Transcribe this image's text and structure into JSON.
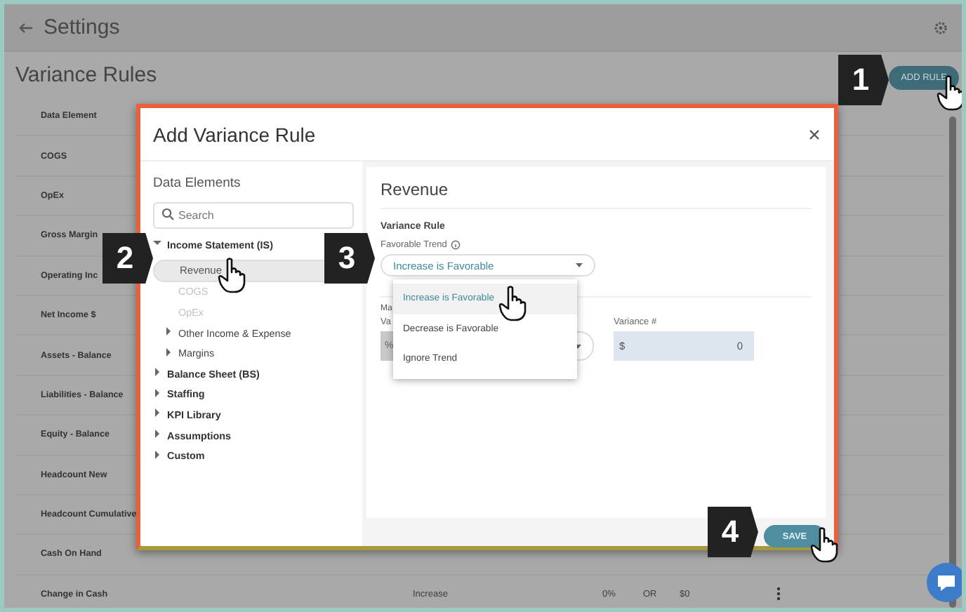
{
  "top_bar": {
    "title": "Settings"
  },
  "page": {
    "title": "Variance Rules",
    "add_button": "ADD RULE"
  },
  "table": {
    "rows": [
      {
        "element": "Data Element",
        "cells": []
      },
      {
        "element": "COGS",
        "cells": []
      },
      {
        "element": "OpEx",
        "cells": []
      },
      {
        "element": "Gross Margin",
        "cells": []
      },
      {
        "element": "Operating Inc",
        "cells": []
      },
      {
        "element": "Net Income $",
        "cells": []
      },
      {
        "element": "Assets - Balance",
        "cells": []
      },
      {
        "element": "Liabilities - Balance",
        "cells": []
      },
      {
        "element": "Equity - Balance",
        "cells": []
      },
      {
        "element": "Headcount New",
        "cells": []
      },
      {
        "element": "Headcount Cumulative",
        "cells": []
      },
      {
        "element": "Cash On Hand",
        "cells": []
      },
      {
        "element": "Change in Cash",
        "cells": [
          "Increase",
          "0%",
          "OR",
          "$0"
        ]
      }
    ]
  },
  "dialog": {
    "title": "Add Variance Rule",
    "left_panel": {
      "heading": "Data Elements",
      "search": {
        "placeholder": "Search"
      },
      "tree": [
        {
          "label": "Income Statement (IS)",
          "kind": "group",
          "expanded": true,
          "children": [
            {
              "label": "Revenue",
              "kind": "leaf",
              "selected": true,
              "disabled": false
            },
            {
              "label": "COGS",
              "kind": "leaf",
              "selected": false,
              "disabled": true
            },
            {
              "label": "OpEx",
              "kind": "leaf",
              "selected": false,
              "disabled": true
            },
            {
              "label": "Other Income & Expense",
              "kind": "group",
              "expanded": false
            },
            {
              "label": "Margins",
              "kind": "group",
              "expanded": false
            }
          ]
        },
        {
          "label": "Balance Sheet (BS)",
          "kind": "group",
          "expanded": false
        },
        {
          "label": "Staffing",
          "kind": "group",
          "expanded": false
        },
        {
          "label": "KPI Library",
          "kind": "group",
          "expanded": false
        },
        {
          "label": "Assumptions",
          "kind": "group",
          "expanded": false
        },
        {
          "label": "Custom",
          "kind": "group",
          "expanded": false
        }
      ]
    },
    "form": {
      "heading": "Revenue",
      "section": "Variance Rule",
      "trend_label": "Favorable Trend",
      "trend_value": "Increase is Favorable",
      "trend_options": [
        {
          "label": "Increase is Favorable",
          "selected": true
        },
        {
          "label": "Decrease is Favorable",
          "selected": false
        },
        {
          "label": "Ignore Trend",
          "selected": false
        }
      ],
      "hidden_label_1": "Ma",
      "hidden_label_2": "Va",
      "percent_field": "%",
      "variance_label": "Variance #",
      "variance_prefix": "$",
      "variance_value": "0"
    },
    "save_button": "SAVE"
  },
  "callouts": [
    "1",
    "2",
    "3",
    "4"
  ]
}
